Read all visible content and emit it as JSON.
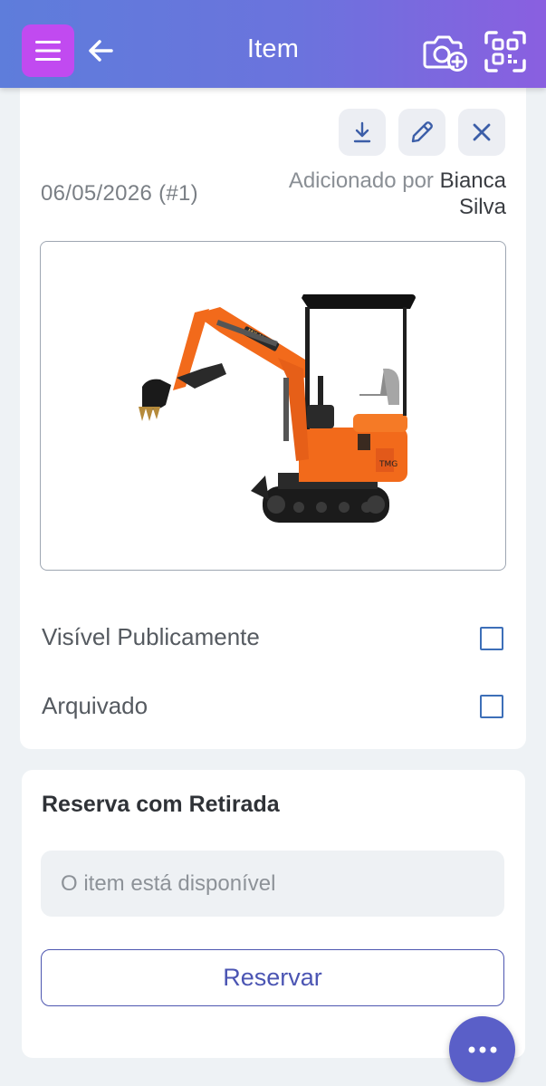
{
  "header": {
    "title": "Item",
    "menu_icon": "menu-icon",
    "back_icon": "arrow-left-icon",
    "camera_icon": "camera-plus-icon",
    "qr_icon": "qr-scan-icon",
    "gradient_start": "#5e7ddb",
    "gradient_end": "#8a5fe0",
    "menu_button_color": "#c14af0"
  },
  "item": {
    "actions": {
      "download_icon": "download-icon",
      "edit_icon": "pencil-icon",
      "close_icon": "close-icon"
    },
    "date": "06/05/2026 (#1)",
    "added_by_prefix": "Adicionado por",
    "added_by_name": "Bianca Silva",
    "image_subject": "mini excavator"
  },
  "options": {
    "public_label": "Visível Publicamente",
    "public_checked": false,
    "archived_label": "Arquivado",
    "archived_checked": false
  },
  "reservation": {
    "title": "Reserva com Retirada",
    "status": "O item está disponível",
    "button_label": "Reservar"
  },
  "fab": {
    "icon": "more-dots-icon",
    "color": "#5a5fc8"
  }
}
